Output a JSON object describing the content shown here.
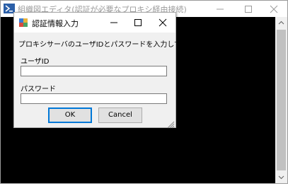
{
  "window": {
    "title": "組織図エディタ(認証が必要なプロキシ経由接続)",
    "icon": "powershell-icon"
  },
  "dialog": {
    "title": "認証情報入力",
    "icon": "app-icon",
    "message": "プロキシサーバのユーザIDとパスワードを入力してください。",
    "user_label": "ユーザID",
    "user_value": "",
    "password_label": "パスワード",
    "password_value": "",
    "ok_label": "OK",
    "cancel_label": "Cancel"
  },
  "colors": {
    "console_bg": "#000000",
    "dialog_bg": "#f0f0f0",
    "accent": "#0078d7"
  }
}
